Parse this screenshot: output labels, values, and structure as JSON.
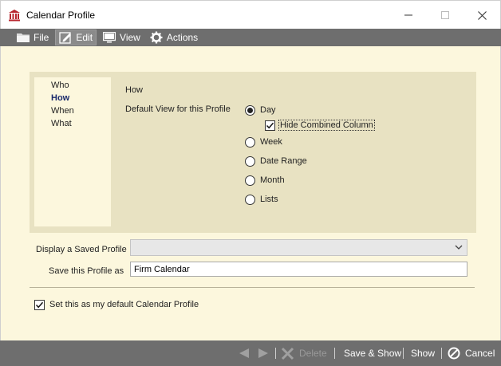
{
  "window": {
    "title": "Calendar Profile"
  },
  "menu": {
    "file": "File",
    "edit": "Edit",
    "view": "View",
    "actions": "Actions"
  },
  "nav": {
    "items": [
      "Who",
      "How",
      "When",
      "What"
    ],
    "selected": "How"
  },
  "how_section": {
    "title": "How",
    "default_view_label": "Default View for this Profile",
    "options": [
      {
        "label": "Day",
        "checked": true
      },
      {
        "label": "Week",
        "checked": false
      },
      {
        "label": "Date Range",
        "checked": false
      },
      {
        "label": "Month",
        "checked": false
      },
      {
        "label": "Lists",
        "checked": false
      }
    ],
    "hide_combined": {
      "label": "Hide Combined Column",
      "checked": true
    }
  },
  "profile": {
    "display_saved_label": "Display a Saved Profile",
    "display_saved_value": "",
    "save_as_label": "Save this Profile as",
    "save_as_value": "Firm Calendar",
    "set_default_label": "Set this as my default Calendar Profile",
    "set_default_checked": true
  },
  "footer": {
    "delete": "Delete",
    "save_show": "Save & Show",
    "show": "Show",
    "cancel": "Cancel"
  },
  "colors": {
    "content_bg": "#fcf7dd",
    "panel_bg": "#e8e2c2",
    "bar_bg": "#6e6e6e",
    "selected_nav": "#1a2a6b"
  }
}
